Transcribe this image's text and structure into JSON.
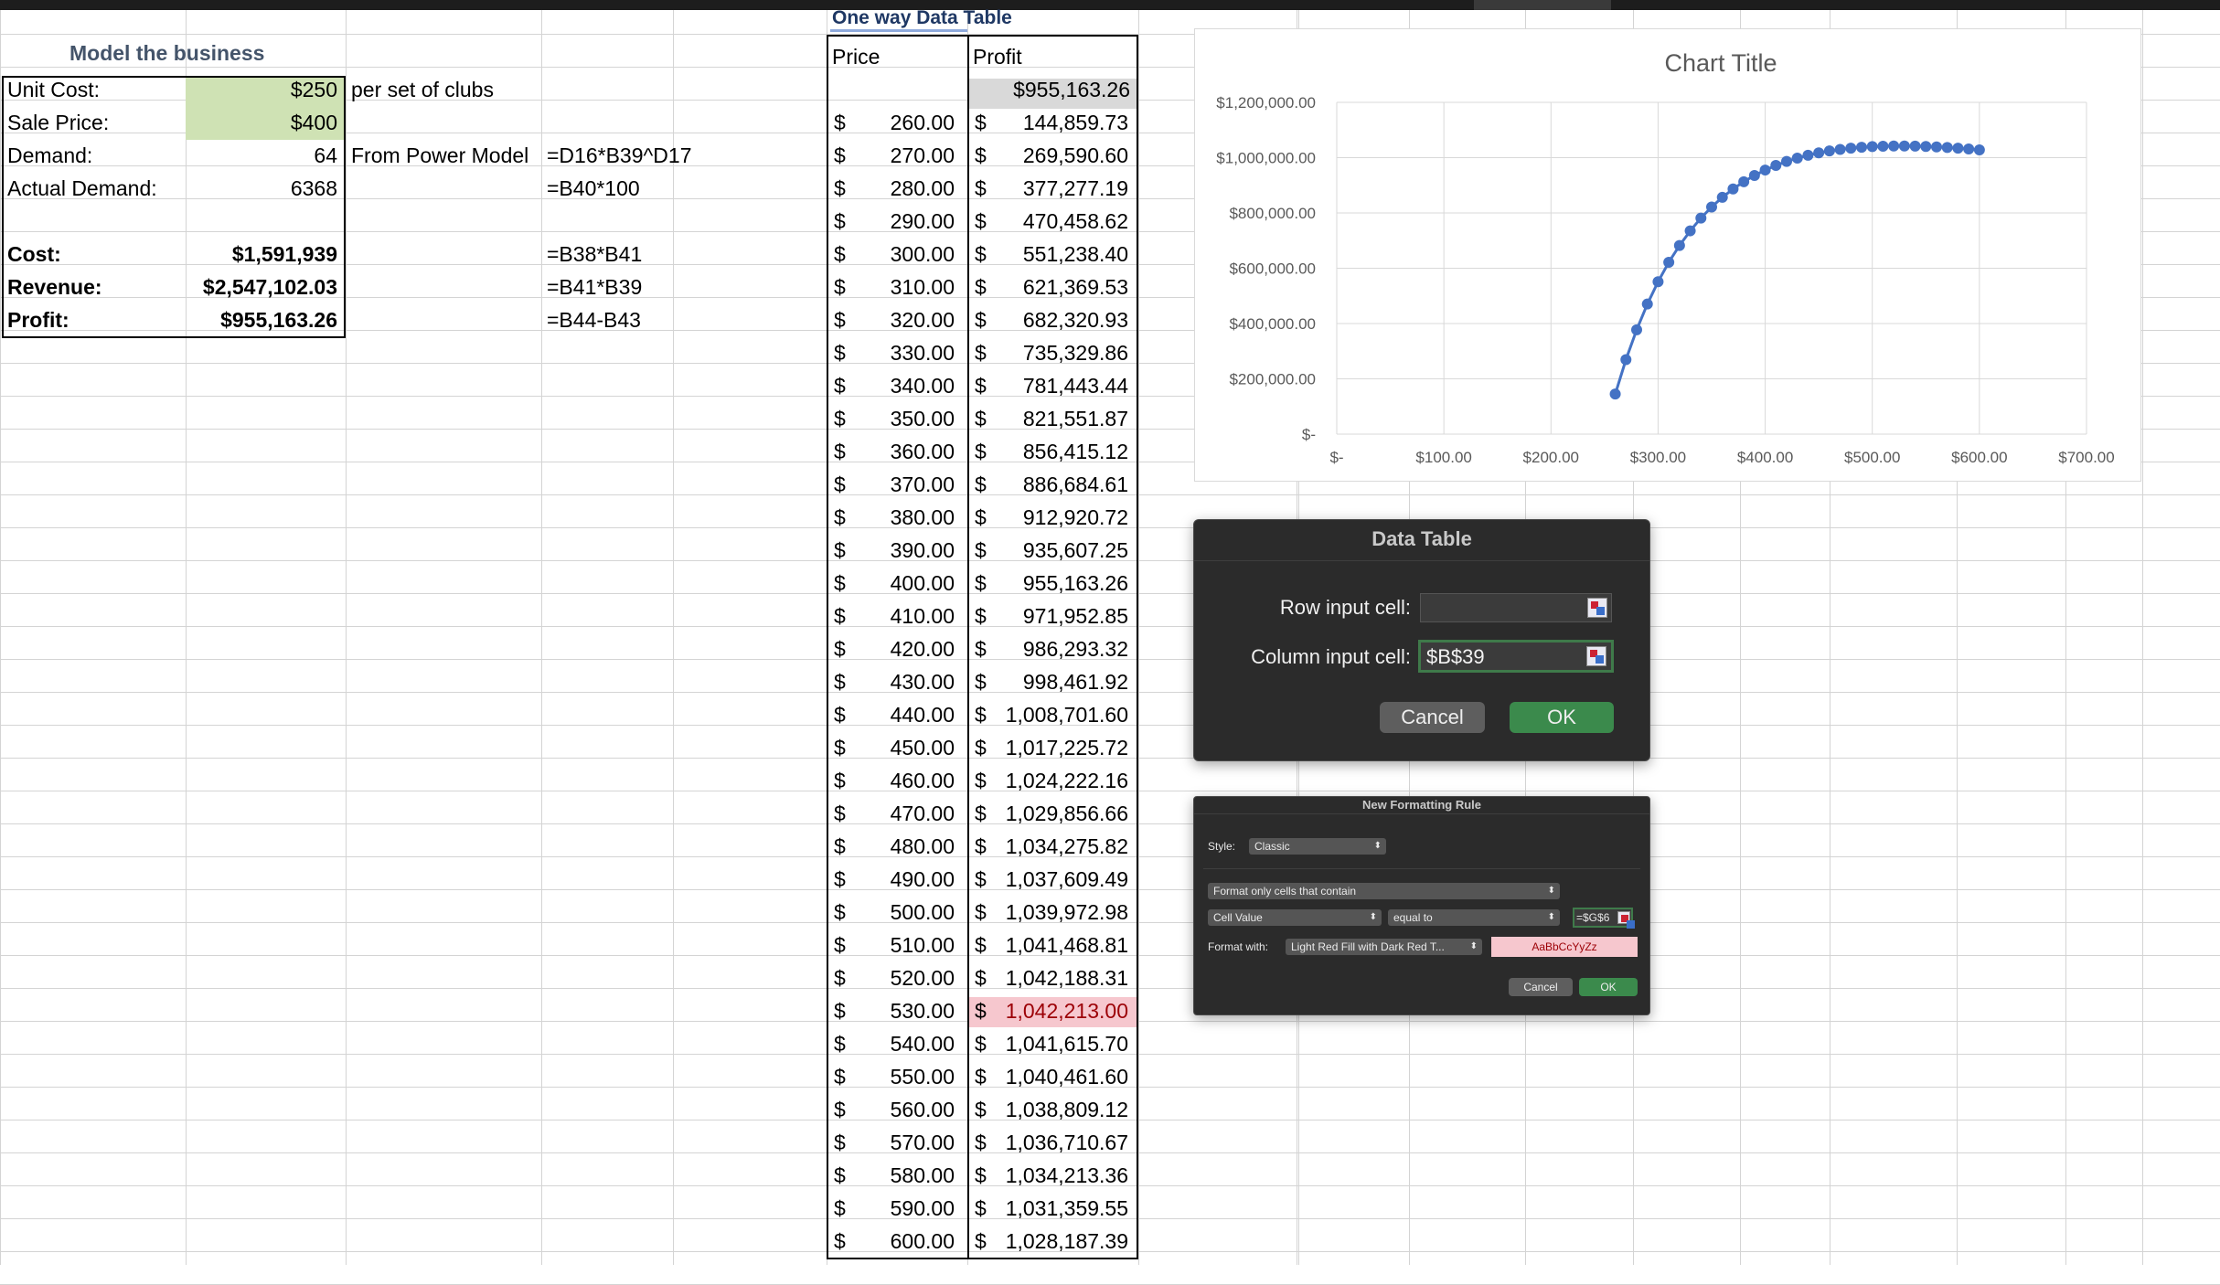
{
  "model": {
    "header": "Model the business",
    "rows": [
      {
        "label": "Unit Cost:",
        "value": "$250",
        "note": "per set of clubs",
        "formula": ""
      },
      {
        "label": "Sale Price:",
        "value": "$400",
        "note": "",
        "formula": ""
      },
      {
        "label": "Demand:",
        "value": "64",
        "note": "From Power Model",
        "formula": "=D16*B39^D17"
      },
      {
        "label": "Actual Demand:",
        "value": "6368",
        "note": "",
        "formula": "=B40*100"
      }
    ],
    "results": [
      {
        "label": "Cost:",
        "value": "$1,591,939",
        "formula": "=B38*B41"
      },
      {
        "label": "Revenue:",
        "value": "$2,547,102.03",
        "formula": "=B41*B39"
      },
      {
        "label": "Profit:",
        "value": "$955,163.26",
        "formula": "=B44-B43"
      }
    ]
  },
  "data_table": {
    "title": "One way Data Table",
    "col_price": "Price",
    "col_profit": "Profit",
    "top_profit": "$955,163.26",
    "currency": "$",
    "rows": [
      [
        "260.00",
        "144,859.73"
      ],
      [
        "270.00",
        "269,590.60"
      ],
      [
        "280.00",
        "377,277.19"
      ],
      [
        "290.00",
        "470,458.62"
      ],
      [
        "300.00",
        "551,238.40"
      ],
      [
        "310.00",
        "621,369.53"
      ],
      [
        "320.00",
        "682,320.93"
      ],
      [
        "330.00",
        "735,329.86"
      ],
      [
        "340.00",
        "781,443.44"
      ],
      [
        "350.00",
        "821,551.87"
      ],
      [
        "360.00",
        "856,415.12"
      ],
      [
        "370.00",
        "886,684.61"
      ],
      [
        "380.00",
        "912,920.72"
      ],
      [
        "390.00",
        "935,607.25"
      ],
      [
        "400.00",
        "955,163.26"
      ],
      [
        "410.00",
        "971,952.85"
      ],
      [
        "420.00",
        "986,293.32"
      ],
      [
        "430.00",
        "998,461.92"
      ],
      [
        "440.00",
        "1,008,701.60"
      ],
      [
        "450.00",
        "1,017,225.72"
      ],
      [
        "460.00",
        "1,024,222.16"
      ],
      [
        "470.00",
        "1,029,856.66"
      ],
      [
        "480.00",
        "1,034,275.82"
      ],
      [
        "490.00",
        "1,037,609.49"
      ],
      [
        "500.00",
        "1,039,972.98"
      ],
      [
        "510.00",
        "1,041,468.81"
      ],
      [
        "520.00",
        "1,042,188.31"
      ],
      [
        "530.00",
        "1,042,213.00"
      ],
      [
        "540.00",
        "1,041,615.70"
      ],
      [
        "550.00",
        "1,040,461.60"
      ],
      [
        "560.00",
        "1,038,809.12"
      ],
      [
        "570.00",
        "1,036,710.67"
      ],
      [
        "580.00",
        "1,034,213.36"
      ],
      [
        "590.00",
        "1,031,359.55"
      ],
      [
        "600.00",
        "1,028,187.39"
      ]
    ],
    "highlight_row_index": 27,
    "highlight_fill": "#f6c7ce",
    "highlight_text": "#9c0006"
  },
  "chart_data": {
    "type": "scatter",
    "title": "Chart Title",
    "x": [
      260,
      270,
      280,
      290,
      300,
      310,
      320,
      330,
      340,
      350,
      360,
      370,
      380,
      390,
      400,
      410,
      420,
      430,
      440,
      450,
      460,
      470,
      480,
      490,
      500,
      510,
      520,
      530,
      540,
      550,
      560,
      570,
      580,
      590,
      600
    ],
    "y": [
      144859.73,
      269590.6,
      377277.19,
      470458.62,
      551238.4,
      621369.53,
      682320.93,
      735329.86,
      781443.44,
      821551.87,
      856415.12,
      886684.61,
      912920.72,
      935607.25,
      955163.26,
      971952.85,
      986293.32,
      998461.92,
      1008701.6,
      1017225.72,
      1024222.16,
      1029856.66,
      1034275.82,
      1037609.49,
      1039972.98,
      1041468.81,
      1042188.31,
      1042213.0,
      1041615.7,
      1040461.6,
      1038809.12,
      1036710.67,
      1034213.36,
      1031359.55,
      1028187.39
    ],
    "xlim": [
      0,
      700
    ],
    "ylim": [
      0,
      1200000
    ],
    "x_ticks": [
      "$-",
      "$100.00",
      "$200.00",
      "$300.00",
      "$400.00",
      "$500.00",
      "$600.00",
      "$700.00"
    ],
    "y_ticks": [
      "$-",
      "$200,000.00",
      "$400,000.00",
      "$600,000.00",
      "$800,000.00",
      "$1,000,000.00",
      "$1,200,000.00"
    ],
    "grid": true,
    "series_color": "#4472c4"
  },
  "data_table_dialog": {
    "title": "Data Table",
    "row_label": "Row input cell:",
    "row_value": "",
    "col_label": "Column input cell:",
    "col_value": "$B$39",
    "cancel": "Cancel",
    "ok": "OK"
  },
  "format_dialog": {
    "title": "New Formatting Rule",
    "style_label": "Style:",
    "style_value": "Classic",
    "rule_type": "Format only cells that contain",
    "condition1": "Cell Value",
    "condition2": "equal to",
    "value": "=$G$6",
    "format_label": "Format with:",
    "format_value": "Light Red Fill with Dark Red T...",
    "preview": "AaBbCcYyZz",
    "cancel": "Cancel",
    "ok": "OK"
  }
}
